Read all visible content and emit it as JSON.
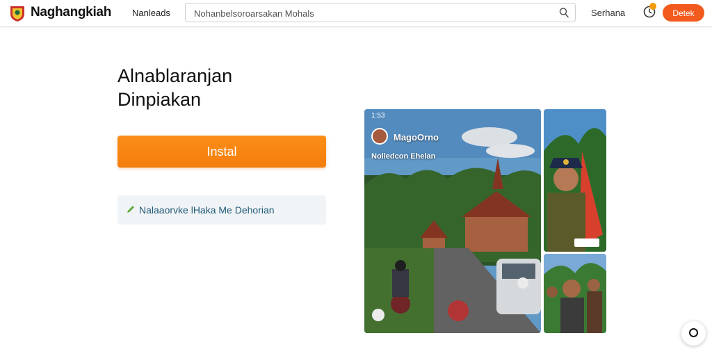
{
  "header": {
    "brand": "Naghangkiah",
    "nav_link": "Nanleads",
    "search_placeholder": "Nohanbelsoroarsakan Mohals",
    "language": "Serhana",
    "login_label": "Detek"
  },
  "hero": {
    "title_line1": "Alnablaranjan",
    "title_line2": "Dinpiakan",
    "install_label": "Instal",
    "link_label": "Nalaaorvke lHaka Me Dehorian"
  },
  "media": {
    "status_time": "1:53",
    "overlay_name": "MagoOrno",
    "overlay_sub": "Nolledcon Ehelan"
  },
  "colors": {
    "accent_orange": "#f47d0b",
    "login_red": "#f25a1e",
    "link_blue": "#1f5a77",
    "notif_dot": "#f59a0b"
  },
  "icons": {
    "logo": "crest-logo-icon",
    "search": "search-icon",
    "notification": "bell-icon",
    "link": "pencil-icon",
    "chat": "chat-icon"
  }
}
